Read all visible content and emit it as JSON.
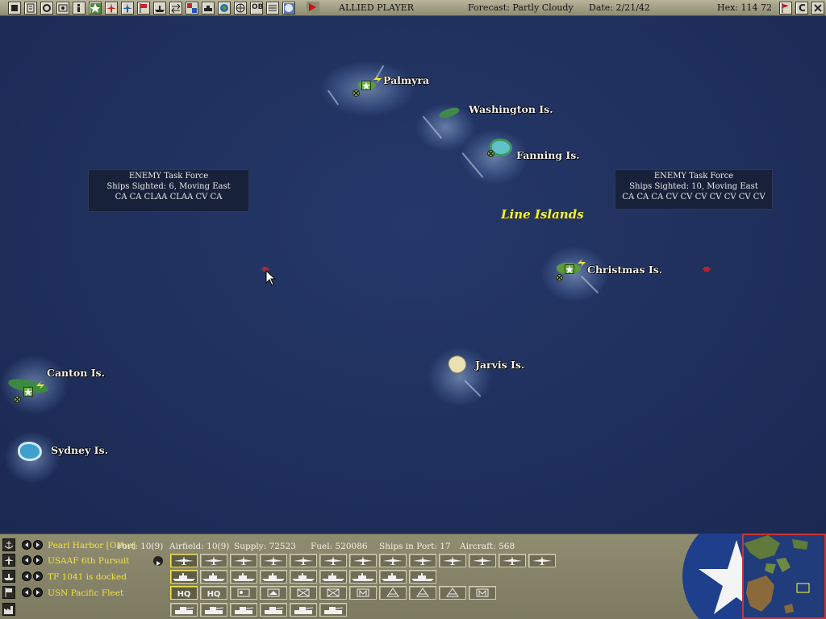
{
  "topbar": {
    "player": "ALLIED PLAYER",
    "forecast": "Forecast: Partly Cloudy",
    "date": "Date: 2/21/42",
    "hex": "Hex: 114  72",
    "buttons": [
      "end-turn-icon",
      "report-icon",
      "intelligence-icon",
      "operations-icon",
      "info-icon",
      "airfield-icon",
      "aircraft-icon",
      "air-mission-icon",
      "flag-icon",
      "ship-icon",
      "swap-icon",
      "mission-icon",
      "ground-icon",
      "bases-icon",
      "globe-icon",
      "refresh-icon",
      "ob-icon",
      "list-icon",
      "dial-icon",
      "end-turn-play-icon"
    ],
    "ob_label": "OB",
    "right_buttons": [
      "flag-red-icon",
      "c-icon",
      "close-icon"
    ],
    "c_label": "C"
  },
  "map": {
    "islands": [
      {
        "name": "Palmyra"
      },
      {
        "name": "Washington Is."
      },
      {
        "name": "Fanning Is."
      },
      {
        "name": "Christmas Is."
      },
      {
        "name": "Jarvis Is."
      },
      {
        "name": "Canton Is."
      },
      {
        "name": "Sydney Is."
      }
    ],
    "region": "Line Islands",
    "task_forces": [
      {
        "title": "ENEMY Task Force",
        "sighted": "Ships Sighted: 6, Moving East",
        "ships": "CA CA CLAA CLAA CV CA"
      },
      {
        "title": "ENEMY Task Force",
        "sighted": "Ships Sighted: 10, Moving East",
        "ships": "CA CA CA CV CV CV CV CV CV CV"
      }
    ]
  },
  "bottom": {
    "rows": [
      {
        "icon": "anchor-icon",
        "label": "Pearl Harbor [Oahu]"
      },
      {
        "icon": "aircraft-icon",
        "label": "USAAF 6th Pursuit"
      },
      {
        "icon": "ship-icon",
        "label": "TF 1041 is docked"
      },
      {
        "icon": "flag-icon",
        "label": "USN Pacific Fleet"
      }
    ],
    "stats": {
      "port": "Port: 10(9)",
      "airfield": "Airfield: 10(9)",
      "supply": "Supply: 72523",
      "fuel": "Fuel: 520086",
      "ships": "Ships in Port: 17",
      "aircraft": "Aircraft: 568"
    },
    "aircraft_buttons": 13,
    "ship_buttons": 9,
    "command_buttons": [
      "HQ",
      "HQ",
      "map",
      "map2",
      "cross",
      "cross",
      "M",
      "A",
      "A",
      "A",
      "M"
    ],
    "ground_buttons": 6
  },
  "colors": {
    "ocean": "#1f2d55",
    "panel": "#8f8c70",
    "label_yellow": "#f0e246",
    "region_label": "#f2f230"
  }
}
